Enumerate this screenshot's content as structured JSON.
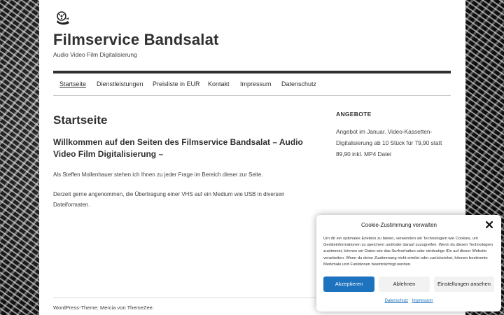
{
  "header": {
    "site_title": "Filmservice Bandsalat",
    "site_description": "Audio Video Film Digitalisierung",
    "logo_icon": "filmreel-mascot-icon"
  },
  "nav": {
    "items": [
      {
        "label": "Startseite",
        "active": true
      },
      {
        "label": "Dienstleistungen"
      },
      {
        "label": "Preisliste in EUR"
      },
      {
        "label": "Kontakt"
      },
      {
        "label": "Impressum"
      },
      {
        "label": "Datenschutz"
      }
    ]
  },
  "main": {
    "page_title": "Startseite",
    "intro_heading": "Willkommen auf den Seiten des Filmservice Bandsalat – Audio Video Film Digitalisierung –",
    "paragraphs": [
      "Als Steffen Mollenhauer stehen ich Ihnen zu jeder Frage im Bereich dieser zur Seite.",
      "Derzeit gerne angenommen, die Übertragung einer VHS auf ein Medium wie USB in diversen Dateiformaten."
    ]
  },
  "sidebar": {
    "widget_title": "ANGEBOTE",
    "widget_text": "Angebot im Januar. Video-Kassetten-Digitalisierung ab 10 Stück für 79,90 statt 89,90 inkl. MP4 Datei"
  },
  "footer": {
    "text": "WordPress-Theme: Mercia von ThemeZee."
  },
  "cookie": {
    "title": "Cookie-Zustimmung verwalten",
    "text": "Um dir ein optimales Erlebnis zu bieten, verwenden wir Technologien wie Cookies, um Geräteinformationen zu speichern und/oder darauf zuzugreifen. Wenn du diesen Technologien zustimmst, können wir Daten wie das Surfverhalten oder eindeutige IDs auf dieser Website verarbeiten. Wenn du deine Zustimmung nicht erteilst oder zurückziehst, können bestimmte Merkmale und Funktionen beeinträchtigt werden.",
    "accept_label": "Akzeptieren",
    "deny_label": "Ablehnen",
    "settings_label": "Einstellungen ansehen",
    "link_privacy": "Datenschutz",
    "link_imprint": "Impressum",
    "accent_color": "#1e73be"
  }
}
